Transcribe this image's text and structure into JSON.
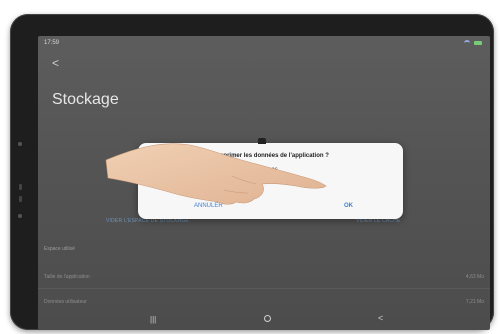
{
  "status_bar": {
    "time": "17:59",
    "indicators": "⚑ ◉ %"
  },
  "header": {
    "back_glyph": "<",
    "title": "Stockage"
  },
  "dialog": {
    "title": "Supprimer les données de l'application ?",
    "body_line1": "Tous les fichiers, paramètres, comptes, bases",
    "body_line2": "de données seront effacés.",
    "cancel_label": "ANNULER",
    "ok_label": "OK"
  },
  "storage": {
    "clear_data_label": "VIDER L'ESPACE DE STOCKAGE",
    "clear_cache_label": "VIDER LE CACHE",
    "section_label": "Espace utilisé",
    "rows": [
      {
        "label": "Taille de l'application",
        "value": "4,63 Mo"
      },
      {
        "label": "Données utilisateur",
        "value": "7,21 Mo"
      }
    ]
  },
  "navbar": {
    "recent_glyph": "|||",
    "back_glyph": "<"
  },
  "colors": {
    "accent": "#3f7fcf",
    "dialog_bg": "#f7f7f7",
    "screen_bg": "#555555",
    "bezel": "#1e1e1e"
  }
}
